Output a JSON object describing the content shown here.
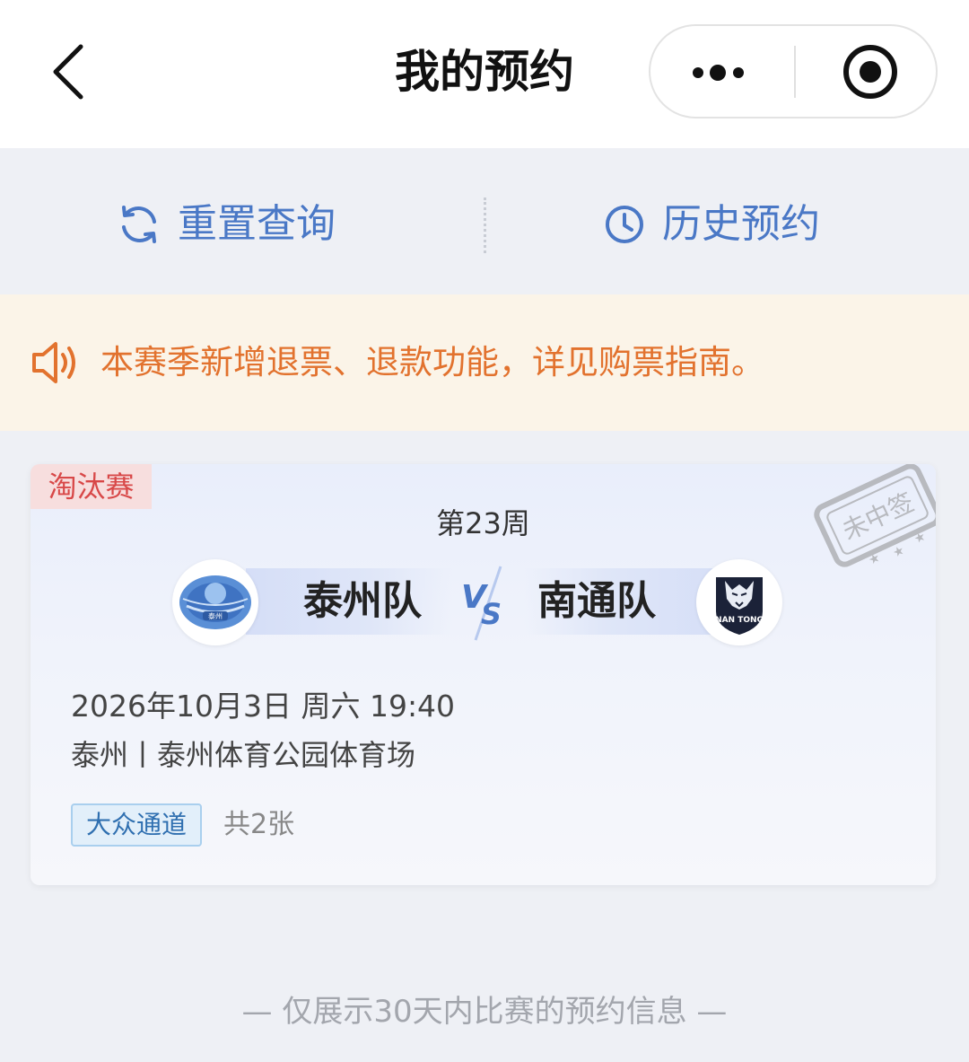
{
  "header": {
    "title": "我的预约"
  },
  "actions": {
    "reset_label": "重置查询",
    "history_label": "历史预约"
  },
  "notice": {
    "text": "本赛季新增退票、退款功能，详见购票指南。"
  },
  "card": {
    "stage_tag": "淘汰赛",
    "stamp_text": "未中签",
    "round": "第23周",
    "home_team": "泰州队",
    "home_logo_text": "泰州",
    "away_team": "南通队",
    "away_logo_text": "NAN TONG",
    "datetime": "2026年10月3日 周六 19:40",
    "venue": "泰州丨泰州体育公园体育场",
    "channel_tag": "大众通道",
    "ticket_count": "共2张"
  },
  "footer": {
    "note": "— 仅展示30天内比赛的预约信息 —"
  },
  "colors": {
    "accent_blue": "#4a78c6",
    "notice_orange": "#e2722e",
    "notice_bg": "#fbf4e8",
    "tag_red": "#d84848",
    "page_bg": "#eef0f5"
  }
}
